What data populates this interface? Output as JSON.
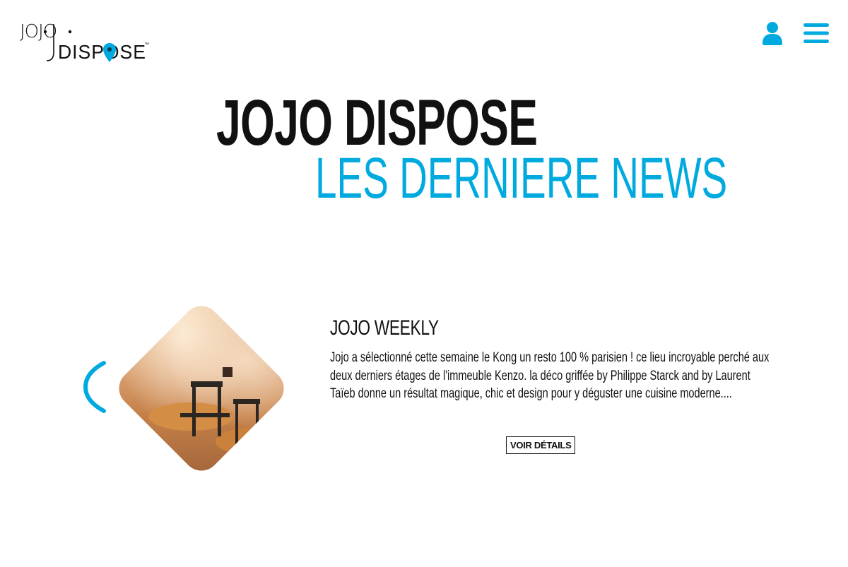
{
  "header": {
    "logo": {
      "top_text": "JOJO",
      "bottom_text": "DISPOSE",
      "trademark": "™",
      "icon": "map-pin-icon"
    },
    "user_icon": "user-icon",
    "menu_icon": "hamburger-menu-icon"
  },
  "hero": {
    "title": "JOJO DISPOSE",
    "subtitle": "LES DERNIERE NEWS"
  },
  "carousel": {
    "prev_icon": "chevron-left-icon",
    "post": {
      "title": "JOJO WEEKLY",
      "excerpt": "Jojo a sélectionné cette semaine le Kong un resto 100 % parisien ! ce lieu incroyable perché aux deux derniers étages de l'immeuble Kenzo. la déco griffée by Philippe Starck and by Laurent Taïeb donne un résultat magique, chic et design pour y déguster une cuisine moderne....",
      "button_label": "VOIR DÉTAILS",
      "image": "restaurant-photo"
    }
  },
  "colors": {
    "accent": "#00aadf",
    "text": "#111111",
    "background": "#ffffff"
  }
}
